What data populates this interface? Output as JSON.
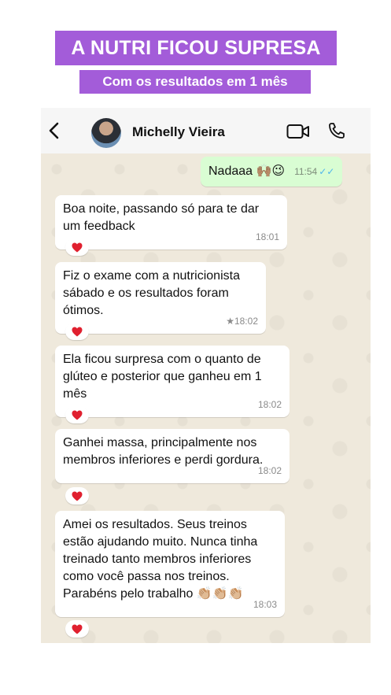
{
  "banner": {
    "headline": "A NUTRI FICOU SUPRESA",
    "subheadline": "Com os resultados em 1 mês"
  },
  "chat_header": {
    "contact_name": "Michelly Vieira",
    "icons": [
      "back-arrow-icon",
      "avatar",
      "video-call-icon",
      "phone-call-icon"
    ]
  },
  "messages": [
    {
      "direction": "outgoing",
      "text": "Nadaaa 🙌🏽😉",
      "time": "11:54",
      "status": "read"
    },
    {
      "direction": "incoming",
      "text": "Boa noite, passando só para te dar um feedback",
      "time": "18:01",
      "reaction": "❤️"
    },
    {
      "direction": "incoming",
      "text": "Fiz o exame com a nutricionista sábado e os resultados foram ótimos.",
      "time": "★18:02",
      "reaction": "❤️"
    },
    {
      "direction": "incoming",
      "text": "Ela ficou surpresa com o quanto de glúteo e posterior que ganheu em 1 mês",
      "time": "18:02",
      "reaction": "❤️"
    },
    {
      "direction": "incoming",
      "text": "Ganhei massa, principalmente nos membros inferiores e perdi gordura.",
      "time": "18:02",
      "reaction": "❤️"
    },
    {
      "direction": "incoming",
      "text": "Amei os resultados. Seus treinos estão ajudando muito. Nunca tinha treinado tanto membros inferiores como você passa nos treinos. Parabéns pelo trabalho 👏🏼👏🏼👏🏼",
      "time": "18:03",
      "reaction": "❤️"
    }
  ],
  "colors": {
    "banner_bg": "#a35cd9",
    "outgoing_bubble": "#d9fdd3",
    "incoming_bubble": "#ffffff",
    "wallpaper": "#efe9dc",
    "read_ticks": "#4fb6ec",
    "heart": "#e0202f"
  }
}
